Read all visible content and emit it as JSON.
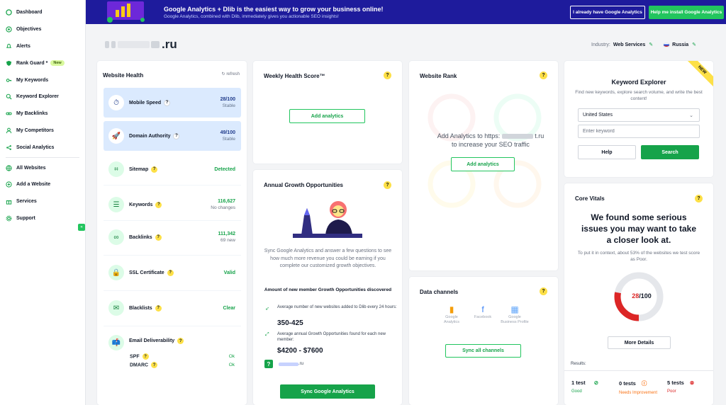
{
  "sidebar": {
    "items": [
      {
        "label": "Dashboard",
        "icon": "dashboard-icon"
      },
      {
        "label": "Objectives",
        "icon": "target-icon"
      },
      {
        "label": "Alerts",
        "icon": "bell-icon"
      },
      {
        "label": "Rank Guard *",
        "icon": "shield-icon",
        "badge": "New"
      },
      {
        "label": "My Keywords",
        "icon": "key-icon"
      },
      {
        "label": "Keyword Explorer",
        "icon": "search-icon"
      },
      {
        "label": "My Backlinks",
        "icon": "link-icon"
      },
      {
        "label": "My Competitors",
        "icon": "users-icon"
      },
      {
        "label": "Social Analytics",
        "icon": "share-icon"
      },
      {
        "label": "All Websites",
        "icon": "globe-icon"
      },
      {
        "label": "Add a Website",
        "icon": "plus-circle-icon"
      },
      {
        "label": "Services",
        "icon": "gift-icon"
      },
      {
        "label": "Support",
        "icon": "gear-icon"
      }
    ],
    "collapse": "«"
  },
  "banner": {
    "title": "Google Analytics + Dlib is the easiest way to grow your business online!",
    "subtitle": "Google Analytics, combined with Dlib, immediately gives you actionable SEO insights!",
    "btn_have": "I already have Google Analytics",
    "btn_install": "Help me install Google Analytics"
  },
  "header": {
    "domain_suffix": ".ru",
    "industry_label": "Industry:",
    "industry_value": "Web Services",
    "country": "Russia"
  },
  "health": {
    "title": "Website Health",
    "refresh": "refresh",
    "rows": [
      {
        "label": "Mobile Speed",
        "value": "28/100",
        "sub": "Stable"
      },
      {
        "label": "Domain Authority",
        "value": "49/100",
        "sub": "Stable"
      },
      {
        "label": "Sitemap",
        "value": "Detected",
        "sub": ""
      },
      {
        "label": "Keywords",
        "value": "116,627",
        "sub": "No changes"
      },
      {
        "label": "Backlinks",
        "value": "111,342",
        "sub": "69 new"
      },
      {
        "label": "SSL Certificate",
        "value": "Valid",
        "sub": ""
      },
      {
        "label": "Blacklists",
        "value": "Clear",
        "sub": ""
      },
      {
        "label": "Email Deliverability",
        "value": "",
        "sub": ""
      }
    ],
    "spf_label": "SPF",
    "spf_value": "Ok",
    "dmarc_label": "DMARC",
    "dmarc_value": "Ok"
  },
  "weekly": {
    "title": "Weekly Health Score™",
    "btn": "Add analytics"
  },
  "annual": {
    "title": "Annual Growth Opportunities",
    "text": "Sync Google Analytics and answer a few questions to see how much more revenue you could be earning if you complete our customized growth objectives.",
    "subhead": "Amount of new member Growth Opportunities discovered",
    "line1": "Average number of new websites added to Dlib every 24 hours:",
    "big1": "350-425",
    "line2": "Average annual Growth Opportunities found for each new member:",
    "big2": "$4200 - $7600",
    "domain_suffix": ".ru",
    "btn": "Sync Google Analytics"
  },
  "rank": {
    "title": "Website Rank",
    "text_line1": "Add Analytics to https:",
    "text_suffix": "t.ru",
    "text_line2": "to increase your SEO traffic",
    "btn": "Add analytics"
  },
  "channels": {
    "title": "Data channels",
    "items": [
      {
        "label": "Google Analytics",
        "icon": "analytics-icon"
      },
      {
        "label": "Facebook",
        "icon": "facebook-icon"
      },
      {
        "label": "Google Business Profile",
        "icon": "business-profile-icon"
      }
    ],
    "btn": "Sync all channels"
  },
  "explorer": {
    "title": "Keyword Explorer",
    "ribbon": "NEW",
    "desc": "Find new keywords, explore search volume, and write the best content!",
    "country": "United States",
    "placeholder": "Enter keyword",
    "help": "Help",
    "search": "Search"
  },
  "vitals": {
    "title": "Core Vitals",
    "headline": "We found some serious issues you may want to take a closer look at.",
    "desc": "To put it in context, about 53% of the websites we test score as Poor.",
    "score": "28",
    "score_total": "/100",
    "more": "More Details",
    "results_label": "Results:",
    "good_count": "1 test",
    "good_label": "Good",
    "ni_count": "0 tests",
    "ni_label": "Needs Improvement",
    "poor_count": "5 tests",
    "poor_label": "Poor"
  },
  "colors": {
    "accent": "#16a34a",
    "banner": "#1e1b9c",
    "danger": "#dc2626",
    "highlight": "#dbeafe"
  }
}
